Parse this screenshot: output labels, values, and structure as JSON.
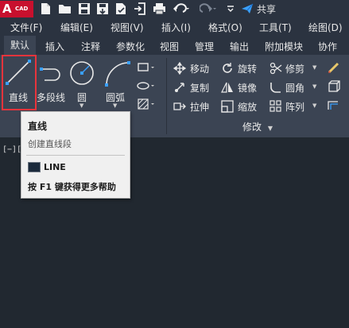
{
  "app": {
    "logo_letter": "A",
    "logo_sub": "CAD"
  },
  "quick_access": {
    "share_label": "共享"
  },
  "menubar": {
    "items": [
      "文件(F)",
      "编辑(E)",
      "视图(V)",
      "插入(I)",
      "格式(O)",
      "工具(T)",
      "绘图(D)"
    ]
  },
  "tabs": {
    "items": [
      "默认",
      "插入",
      "注释",
      "参数化",
      "视图",
      "管理",
      "输出",
      "附加模块",
      "协作"
    ],
    "active": "默认"
  },
  "ribbon": {
    "draw": {
      "line": "直线",
      "polyline": "多段线",
      "circle": "圆",
      "arc": "圆弧"
    },
    "modify": {
      "move": "移动",
      "rotate": "旋转",
      "trim": "修剪",
      "copy": "复制",
      "mirror": "镜像",
      "fillet": "圆角",
      "stretch": "拉伸",
      "scale": "缩放",
      "array": "阵列",
      "panel_title": "修改"
    }
  },
  "viewport": {
    "label": "[−]["
  },
  "tooltip": {
    "title": "直线",
    "description": "创建直线段",
    "command": "LINE",
    "help": "按 F1 键获得更多帮助"
  },
  "colors": {
    "accent_red": "#e8343c",
    "logo_red": "#c8102e",
    "share_blue": "#3aa0ff"
  }
}
